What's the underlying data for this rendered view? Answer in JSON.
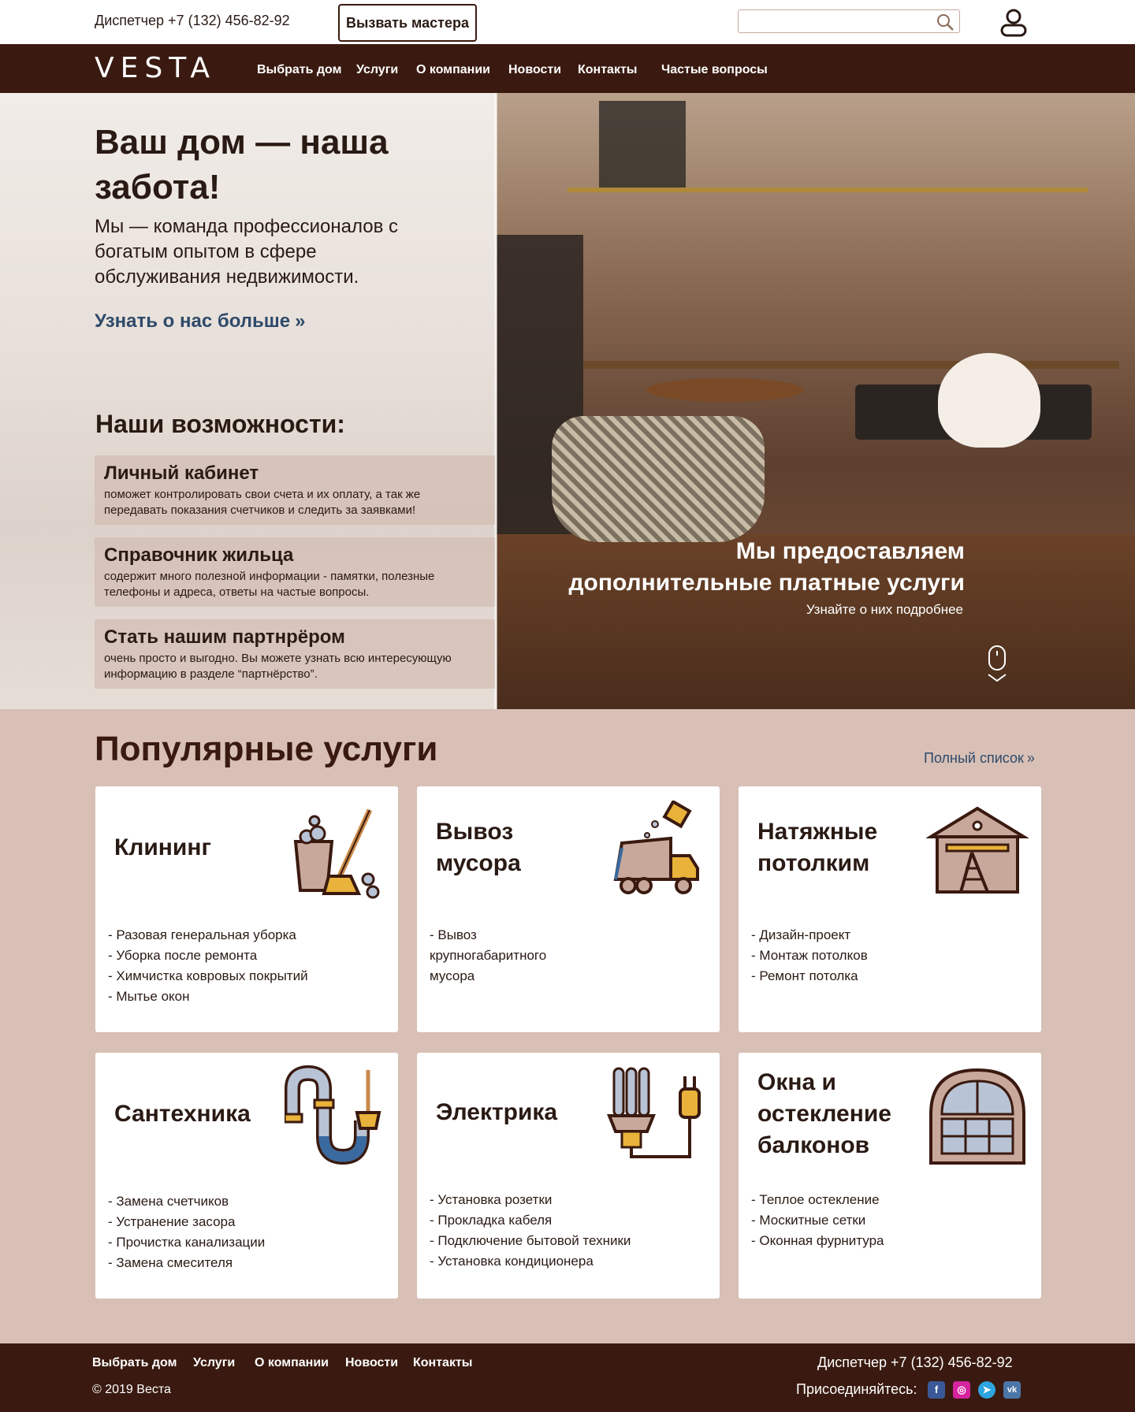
{
  "topbar": {
    "dispatcher": "Диспетчер +7 (132) 456-82-92",
    "call_button": "Вызвать мастера",
    "search_placeholder": ""
  },
  "nav": {
    "logo": "VESTA",
    "items": [
      "Выбрать  дом",
      "Услуги",
      "О компании",
      "Новости",
      "Контакты",
      "Частые вопросы"
    ]
  },
  "hero": {
    "title": "Ваш дом — наша забота!",
    "description": "Мы — команда профессионалов с богатым опытом в сфере обслуживания недвижимости.",
    "link": "Узнать о нас больше",
    "capabilities_title": "Наши возможности:",
    "capabilities": [
      {
        "title": "Личный кабинет",
        "desc": "поможет контролировать свои счета и их оплату, а так же передавать показания счетчиков и следить за заявками!"
      },
      {
        "title": "Справочник жильца",
        "desc": "содержит много полезной информации - памятки, полезные телефоны и адреса, ответы на частые вопросы."
      },
      {
        "title": "Стать нашим партнрёром",
        "desc": "очень просто и выгодно. Вы можете узнать всю интересующую информацию в разделе “партнёрство”."
      }
    ],
    "promo_title": "Мы предоставляем дополнительные платные услуги",
    "promo_sub": "Узнайте о них подробнее"
  },
  "services": {
    "title": "Популярные услуги",
    "full_list": "Полный список",
    "cards": [
      {
        "title": "Клининг",
        "icon": "cleaning-icon",
        "items": [
          "- Разовая генеральная уборка",
          "- Уборка после ремонта",
          "- Химчистка ковровых покрытий",
          "- Мытье окон"
        ]
      },
      {
        "title": "Вывоз мусора",
        "icon": "garbage-truck-icon",
        "items": [
          "- Вывоз крупногабаритного мусора"
        ]
      },
      {
        "title": "Натяжные потолким",
        "icon": "house-ladder-icon",
        "items": [
          "- Дизайн-проект",
          "- Монтаж потолков",
          "- Ремонт потолка"
        ]
      },
      {
        "title": "Сантехника",
        "icon": "pipe-plunger-icon",
        "items": [
          "- Замена счетчиков",
          "- Устранение засора",
          "- Прочистка канализации",
          "- Замена смесителя"
        ]
      },
      {
        "title": "Электрика",
        "icon": "lamp-plug-icon",
        "items": [
          "- Установка розетки",
          "- Прокладка кабеля",
          "- Подключение бытовой техники",
          "- Установка кондиционера"
        ]
      },
      {
        "title": "Окна и остекление балконов",
        "icon": "window-icon",
        "items": [
          "- Теплое остекление",
          "- Москитные сетки",
          "- Оконная фурнитура"
        ]
      }
    ]
  },
  "footer": {
    "nav": [
      "Выбрать дом",
      "Услуги",
      "О компании",
      "Новости",
      "Контакты"
    ],
    "copyright": "© 2019  Веста",
    "dispatcher": "Диспетчер +7 (132) 456-82-92",
    "join": "Присоединяйтесь:",
    "social": [
      {
        "name": "facebook-icon",
        "glyph": "f",
        "color": "#3b5998"
      },
      {
        "name": "instagram-icon",
        "glyph": "◎",
        "color": "#d6249f"
      },
      {
        "name": "telegram-icon",
        "glyph": "➤",
        "color": "#2ca5e0"
      },
      {
        "name": "vk-icon",
        "glyph": "vk",
        "color": "#4a76a8"
      }
    ]
  },
  "colors": {
    "brand_dark": "#3a1a10",
    "services_bg": "#d8c0b6",
    "link_blue": "#2e4a6a"
  }
}
